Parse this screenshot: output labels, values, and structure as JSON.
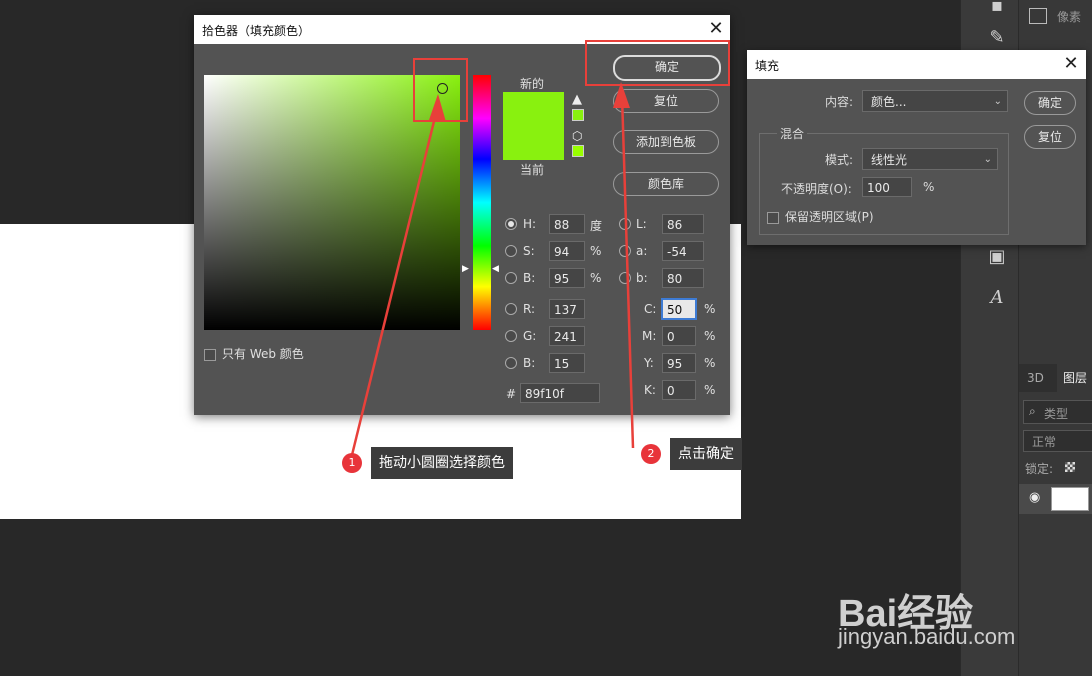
{
  "picker": {
    "title": "拾色器（填充颜色）",
    "close_icon": "✕",
    "label_new": "新的",
    "label_current": "当前",
    "only_web": "只有 Web 颜色",
    "buttons": {
      "ok": "确定",
      "reset": "复位",
      "add_swatch": "添加到色板",
      "color_libraries": "颜色库"
    },
    "hsb": {
      "h_label": "H:",
      "h": "88",
      "h_unit": "度",
      "s_label": "S:",
      "s": "94",
      "s_unit": "%",
      "b_label": "B:",
      "b": "95",
      "b_unit": "%"
    },
    "rgb": {
      "r_label": "R:",
      "r": "137",
      "g_label": "G:",
      "g": "241",
      "b_label": "B:",
      "b": "15"
    },
    "lab": {
      "l_label": "L:",
      "l": "86",
      "a_label": "a:",
      "a": "-54",
      "b_label": "b:",
      "b": "80"
    },
    "cmyk": {
      "c_label": "C:",
      "c": "50",
      "m_label": "M:",
      "m": "0",
      "y_label": "Y:",
      "y": "95",
      "k_label": "K:",
      "k": "0",
      "unit": "%"
    },
    "hex_label": "#",
    "hex": "89f10f",
    "selected_color": "#89f10f"
  },
  "fill": {
    "title": "填充",
    "content_label": "内容:",
    "content_value": "颜色...",
    "blend_label": "混合",
    "mode_label": "模式:",
    "mode_value": "线性光",
    "opacity_label": "不透明度(O):",
    "opacity_value": "100",
    "opacity_unit": "%",
    "preserve_label": "保留透明区域(P)",
    "ok": "确定",
    "reset": "复位"
  },
  "right_panel": {
    "pixels_label": "像素",
    "tab_3d": "3D",
    "tab_layers": "图层",
    "search_placeholder": "类型",
    "blend_mode": "正常",
    "lock_label": "锁定:"
  },
  "annotations": {
    "step1_num": "1",
    "step1_text": "拖动小圆圈选择颜色",
    "step2_num": "2",
    "step2_text": "点击确定"
  },
  "watermark": {
    "logo": "Bai经验",
    "url": "jingyan.baidu.com"
  }
}
